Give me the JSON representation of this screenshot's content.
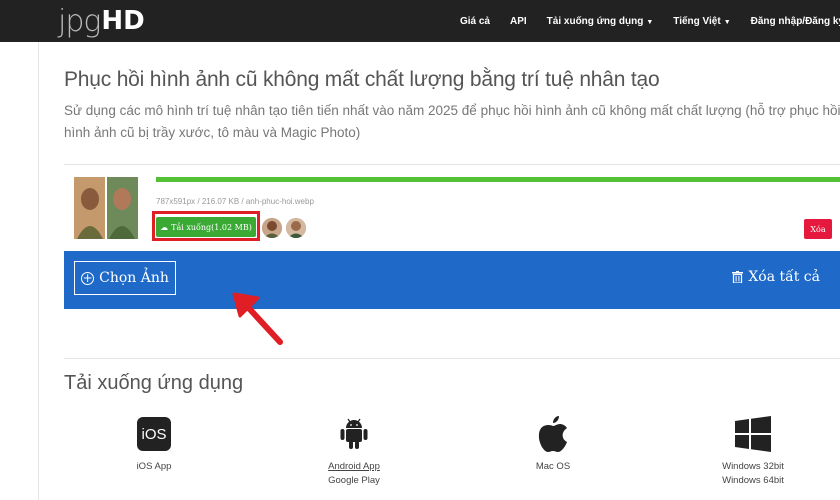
{
  "logo": {
    "part1": "jpg",
    "part2": "HD"
  },
  "nav": {
    "pricing": "Giá cả",
    "api": "API",
    "download_app": "Tải xuống ứng dụng",
    "language": "Tiếng Việt",
    "login": "Đăng nhập/Đăng ký"
  },
  "page": {
    "title": "Phục hồi hình ảnh cũ không mất chất lượng bằng trí tuệ nhân tạo",
    "subtitle": "Sử dụng các mô hình trí tuệ nhân tạo tiên tiến nhất vào năm 2025 để phục hồi hình ảnh cũ không mất chất lượng (hỗ trợ phục hồi hình ảnh cũ bị trầy xước, tô màu và Magic Photo)"
  },
  "file": {
    "info": "787x591px / 216.07 KB / anh-phuc-hoi.webp",
    "download_label": "Tải xuống(1.02 MB)",
    "delete_label": "Xóa",
    "progress": 1.0
  },
  "toolbar": {
    "choose_label": "Chọn Ảnh",
    "clear_all_label": "Xóa tất cả"
  },
  "apps": {
    "heading": "Tải xuống ứng dụng",
    "ios_icon_text": "iOS",
    "ios": "iOS App",
    "android": "Android App",
    "android_sub": "Google Play",
    "mac": "Mac OS",
    "win32": "Windows 32bit",
    "win64": "Windows 64bit"
  },
  "colors": {
    "topbar": "#222222",
    "progress": "#52c234",
    "download_button": "#3aaa35",
    "highlight": "#e01e26",
    "delete_button": "#e5183d",
    "toolbar": "#1f6ac8"
  }
}
